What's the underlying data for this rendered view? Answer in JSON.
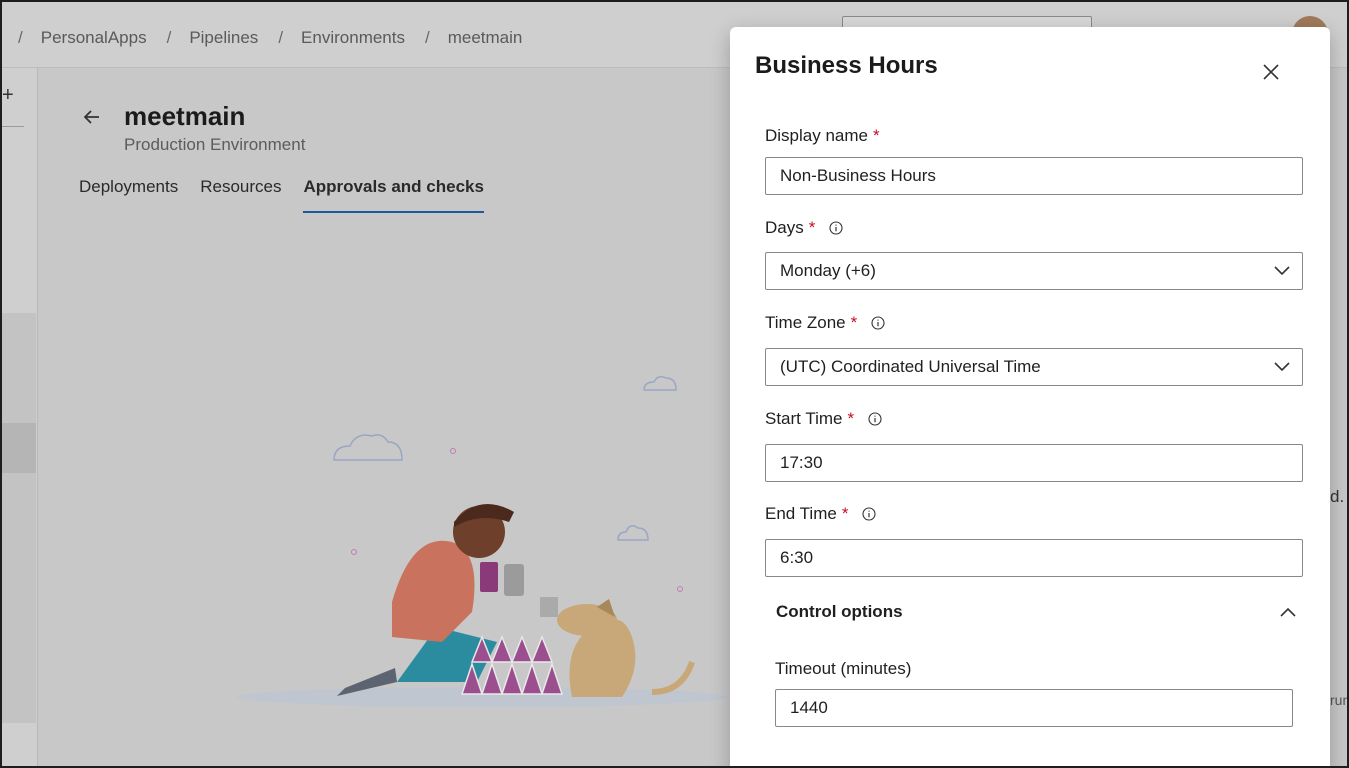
{
  "breadcrumb": {
    "items": [
      "PersonalApps",
      "Pipelines",
      "Environments",
      "meetmain"
    ],
    "separator": "/"
  },
  "leftrail": {
    "add_label": "+"
  },
  "environment": {
    "title": "meetmain",
    "subtitle": "Production Environment",
    "back_icon": "arrow-left-icon",
    "tabs": [
      {
        "label": "Deployments"
      },
      {
        "label": "Resources"
      },
      {
        "label": "Approvals and checks",
        "active": true
      }
    ]
  },
  "background_fragments": {
    "right_text_1": "d.",
    "right_text_2": "run"
  },
  "panel": {
    "title": "Business Hours",
    "close_icon": "close-icon",
    "required_marker": "*",
    "fields": {
      "display_name": {
        "label": "Display name",
        "value": "Non-Business Hours"
      },
      "days": {
        "label": "Days",
        "value": "Monday (+6)"
      },
      "time_zone": {
        "label": "Time Zone",
        "value": "(UTC) Coordinated Universal Time"
      },
      "start_time": {
        "label": "Start Time",
        "value": "17:30"
      },
      "end_time": {
        "label": "End Time",
        "value": "6:30"
      }
    },
    "control_options": {
      "title": "Control options",
      "expanded": true,
      "timeout": {
        "label": "Timeout (minutes)",
        "value": "1440"
      }
    }
  },
  "colors": {
    "required": "#c50f1f",
    "tab_underline": "#1c5a9c",
    "overlay_bg": "#c8c8c8"
  }
}
